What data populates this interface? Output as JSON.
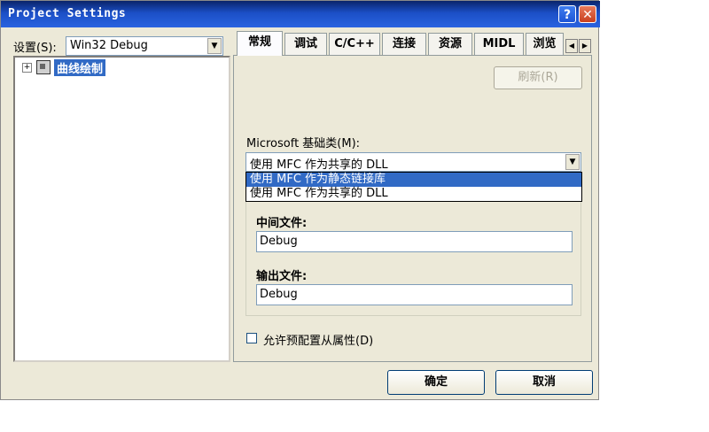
{
  "window": {
    "title": "Project Settings",
    "help_glyph": "?",
    "close_glyph": "✕"
  },
  "settings": {
    "label": "设置(S):",
    "value": "Win32 Debug"
  },
  "tree": {
    "expander": "+",
    "item": "曲线绘制"
  },
  "tabs": [
    "常规",
    "调试",
    "C/C++",
    "连接",
    "资源",
    "MIDL",
    "浏览"
  ],
  "tab_nav": {
    "left": "◀",
    "right": "▶"
  },
  "refresh_button": "刷新(R)",
  "mfc": {
    "label": "Microsoft 基础类(M):",
    "selected": "使用 MFC 作为共享的 DLL",
    "options": [
      "使用 MFC 作为静态链接库",
      "使用 MFC 作为共享的 DLL"
    ]
  },
  "intermediate": {
    "label": "中间文件:",
    "value": "Debug"
  },
  "output": {
    "label": "输出文件:",
    "value": "Debug"
  },
  "allow_checkbox": {
    "label": "允许预配置从属性(D)",
    "checked": false
  },
  "buttons": {
    "ok": "确定",
    "cancel": "取消"
  },
  "colors": {
    "titlebar": "#0a246a",
    "selection": "#316ac5",
    "dialog_bg": "#ece9d8"
  }
}
